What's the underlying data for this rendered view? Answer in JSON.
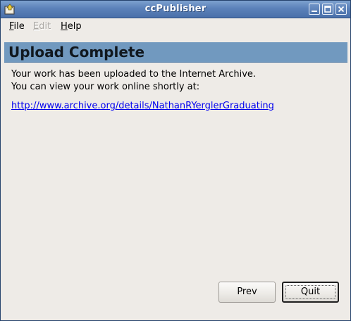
{
  "window": {
    "title": "ccPublisher"
  },
  "menu": {
    "file": {
      "mnemonic": "F",
      "rest": "ile"
    },
    "edit": {
      "mnemonic": "E",
      "rest": "dit"
    },
    "help": {
      "mnemonic": "H",
      "rest": "elp"
    }
  },
  "banner": {
    "title": "Upload Complete"
  },
  "content": {
    "line1": "Your work has been uploaded to the Internet Archive.",
    "line2": "You can view your work online shortly at:",
    "link": "http://www.archive.org/details/NathanRYerglerGraduating"
  },
  "buttons": {
    "prev": "Prev",
    "quit": "Quit"
  },
  "colors": {
    "titlebar": "#5b81b9",
    "banner": "#7199bf",
    "link": "#0000ee"
  }
}
